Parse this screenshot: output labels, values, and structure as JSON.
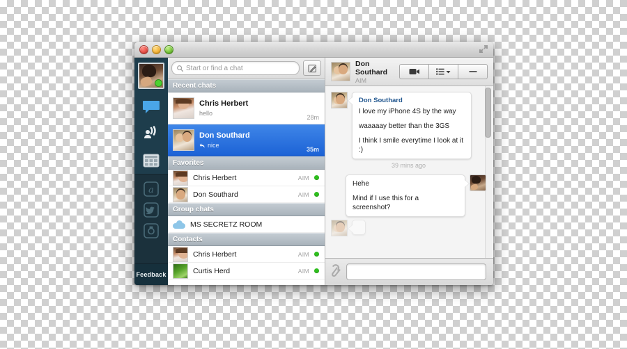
{
  "window": {
    "traffic_lights": [
      "close",
      "minimize",
      "zoom"
    ],
    "fullscreen_icon": "fullscreen-arrows-icon"
  },
  "rail": {
    "user_avatar_alt": "my-avatar",
    "user_status": "online",
    "items": [
      {
        "name": "chat-bubble-icon",
        "label": "Chats"
      },
      {
        "name": "broadcast-icon",
        "label": "Broadcast"
      },
      {
        "name": "grid-icon",
        "label": "Grid"
      }
    ],
    "services": [
      {
        "name": "aim-icon",
        "label": "AIM"
      },
      {
        "name": "twitter-icon",
        "label": "Twitter"
      },
      {
        "name": "camera-icon",
        "label": "Camera"
      }
    ],
    "feedback_label": "Feedback"
  },
  "search": {
    "placeholder": "Start or find a chat",
    "value": "",
    "icon": "search-icon",
    "compose_icon": "compose-pencil-icon"
  },
  "list": {
    "sections": [
      {
        "id": "recent-chats",
        "title": "Recent chats",
        "type": "chats",
        "rows": [
          {
            "name": "Chris Herbert",
            "preview": "hello",
            "time": "28m",
            "avatar": "chris",
            "selected": false,
            "reply": false
          },
          {
            "name": "Don Southard",
            "preview": "nice",
            "time": "35m",
            "avatar": "don",
            "selected": true,
            "reply": true
          }
        ]
      },
      {
        "id": "favorites",
        "title": "Favorites",
        "type": "contacts",
        "rows": [
          {
            "name": "Chris Herbert",
            "network": "AIM",
            "status": "online",
            "avatar": "chris",
            "icon": "avatar"
          },
          {
            "name": "Don Southard",
            "network": "AIM",
            "status": "online",
            "avatar": "don",
            "icon": "avatar"
          }
        ]
      },
      {
        "id": "group-chats",
        "title": "Group chats",
        "type": "groups",
        "rows": [
          {
            "name": "MS SECRETZ ROOM",
            "network": "",
            "status": "",
            "avatar": "",
            "icon": "group-cloud-icon"
          }
        ]
      },
      {
        "id": "contacts",
        "title": "Contacts",
        "type": "contacts",
        "rows": [
          {
            "name": "Chris Herbert",
            "network": "AIM",
            "status": "online",
            "avatar": "chris",
            "icon": "avatar"
          },
          {
            "name": "Curtis Herd",
            "network": "AIM",
            "status": "online",
            "avatar": "curtis",
            "icon": "avatar"
          }
        ]
      }
    ]
  },
  "conversation": {
    "header": {
      "name": "Don Southard",
      "network": "AIM",
      "avatar": "don",
      "buttons": [
        {
          "name": "video-call-button",
          "icon": "video-camera-icon"
        },
        {
          "name": "list-menu-button",
          "icon": "list-icon"
        },
        {
          "name": "minimize-button",
          "icon": "dash-icon"
        }
      ]
    },
    "messages": [
      {
        "direction": "in",
        "sender": "Don Southard",
        "avatar": "don",
        "lines": [
          "I love my iPhone 4S by the way",
          "waaaaay better than the 3GS",
          "I think I smile everytime I look at it :)"
        ],
        "timestamp": "39 mins ago"
      },
      {
        "direction": "out",
        "sender": "",
        "avatar": "me",
        "lines": [
          "Hehe",
          "Mind if I use this for a screenshot?"
        ],
        "timestamp": ""
      }
    ],
    "composer": {
      "attach_icon": "paperclip-icon",
      "input_value": "",
      "input_placeholder": ""
    }
  },
  "colors": {
    "rail_bg": "#1e3a47",
    "selection_blue": "#1c62d6",
    "status_green": "#2fbf1e",
    "sender_blue": "#22578f"
  }
}
